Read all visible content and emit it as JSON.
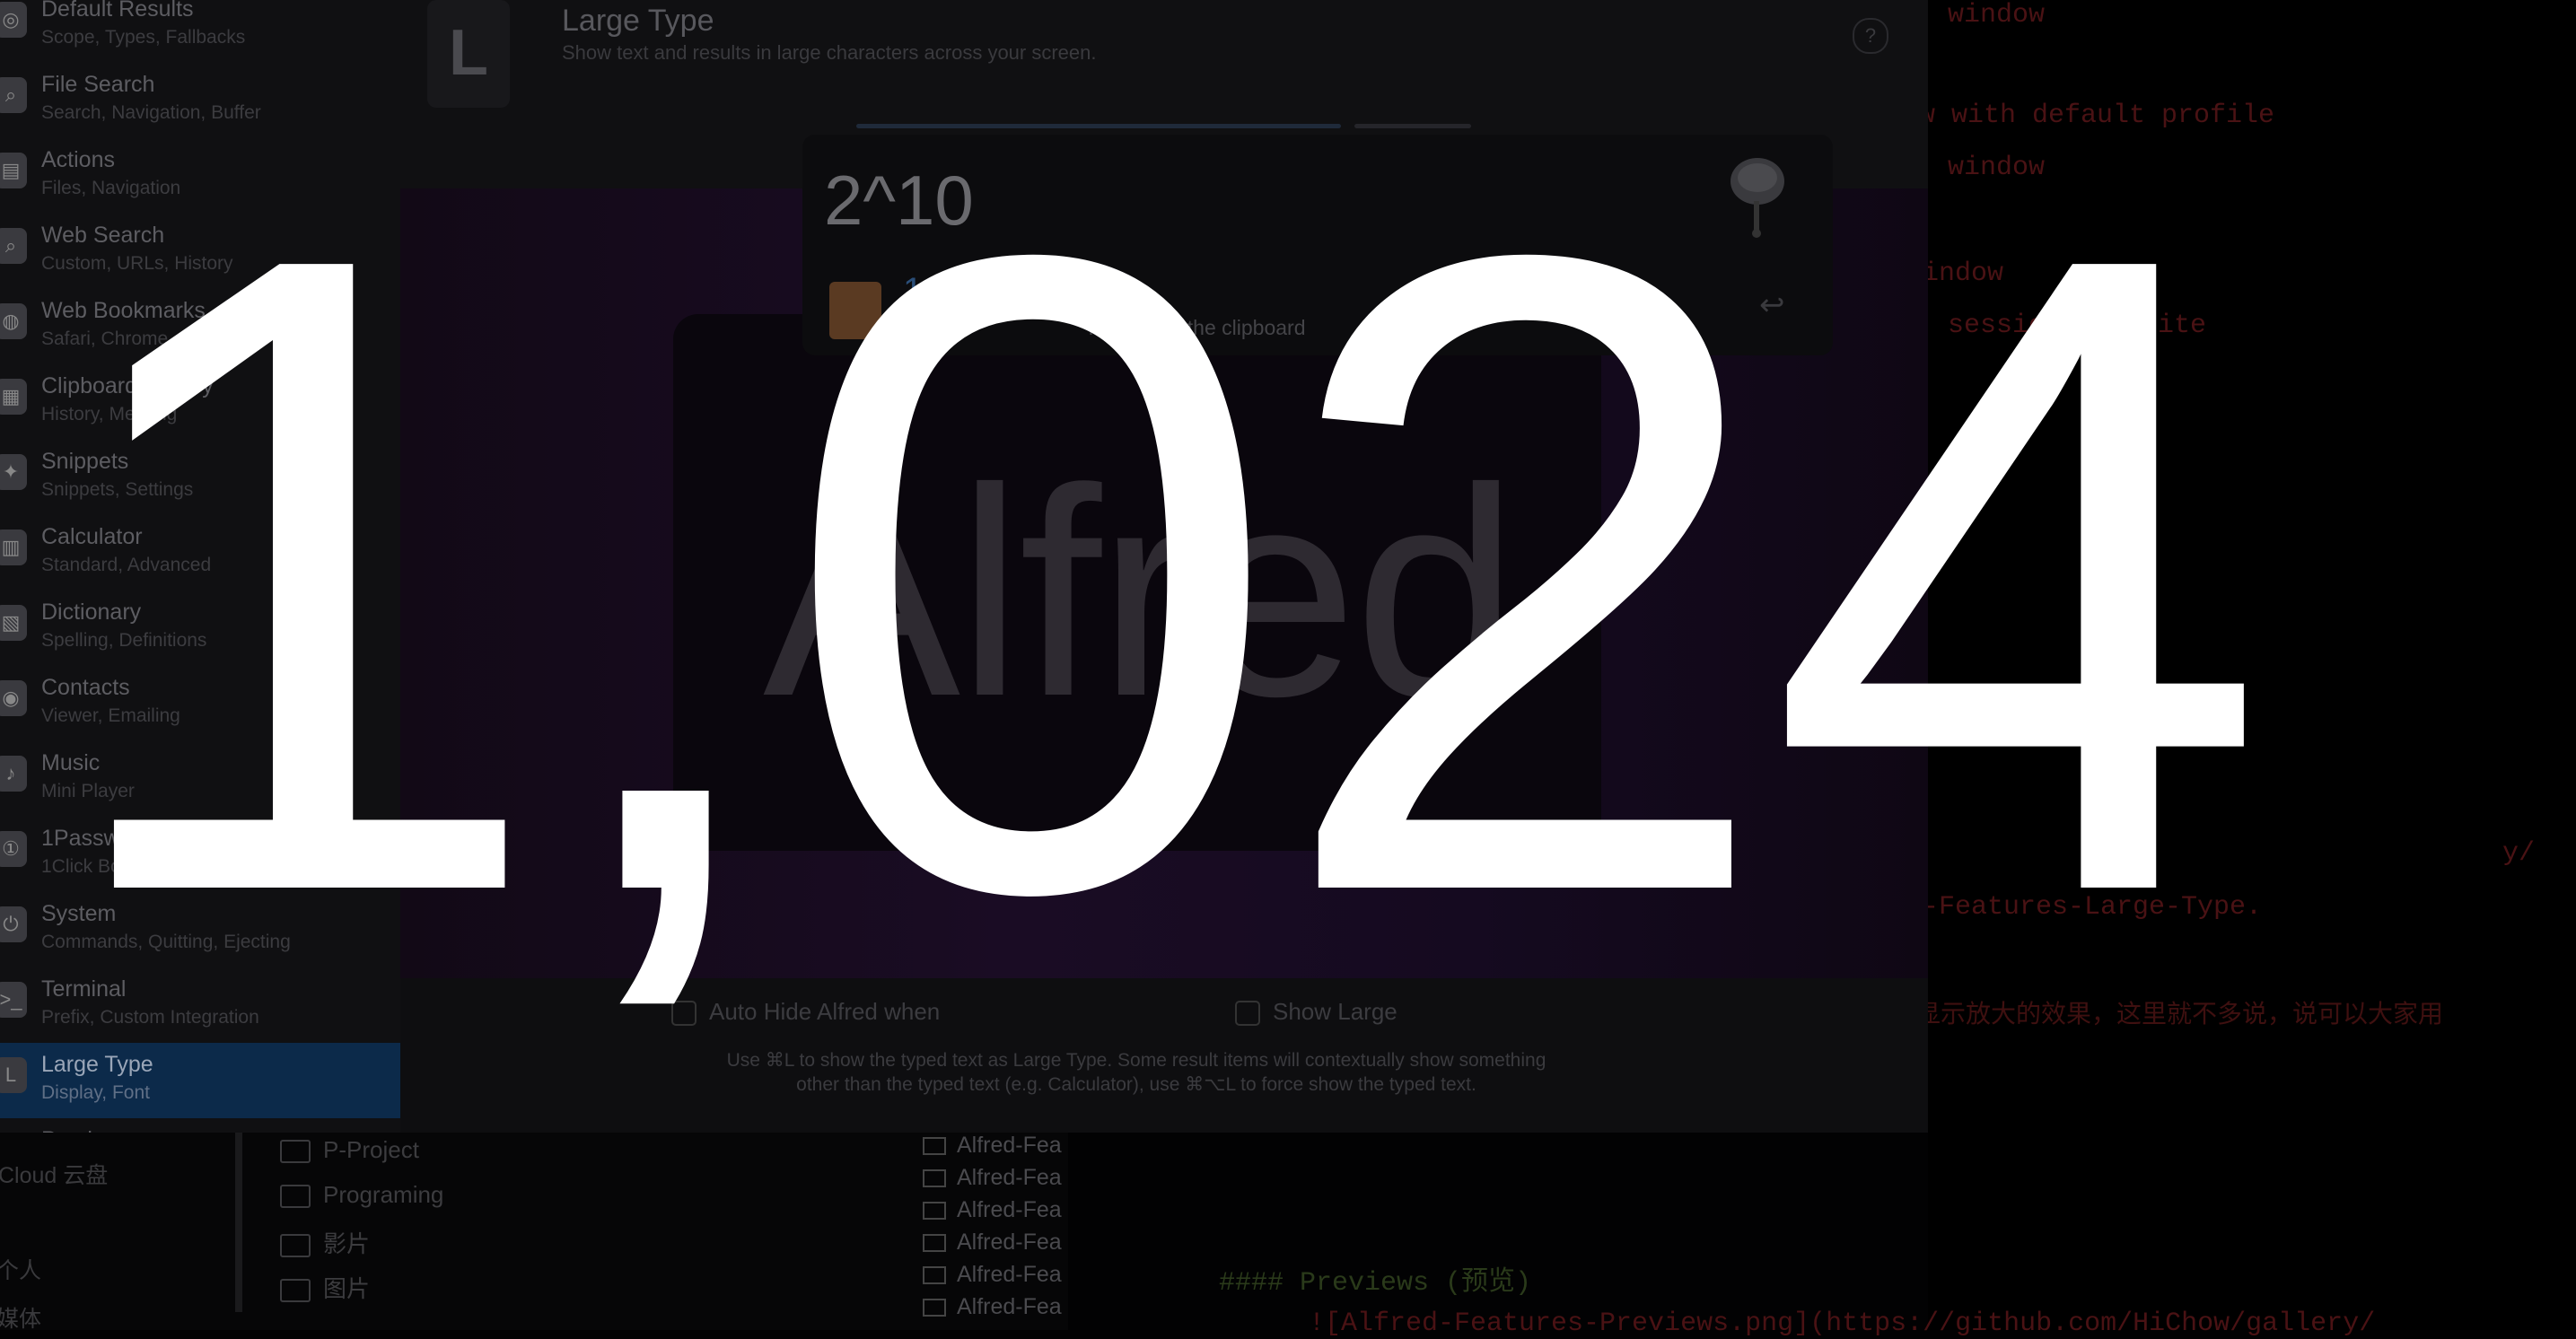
{
  "sidebar": {
    "items": [
      {
        "label": "Default Results",
        "sub": "Scope, Types, Fallbacks",
        "icon": "default-results-icon",
        "glyph": "◎"
      },
      {
        "label": "File Search",
        "sub": "Search, Navigation, Buffer",
        "icon": "file-search-icon",
        "glyph": "⌕"
      },
      {
        "label": "Actions",
        "sub": "Files, Navigation",
        "icon": "actions-icon",
        "glyph": "▤"
      },
      {
        "label": "Web Search",
        "sub": "Custom, URLs, History",
        "icon": "web-search-icon",
        "glyph": "⌕"
      },
      {
        "label": "Web Bookmarks",
        "sub": "Safari, Chrome",
        "icon": "bookmarks-icon",
        "glyph": "◍"
      },
      {
        "label": "Clipboard History",
        "sub": "History, Merging",
        "icon": "clipboard-icon",
        "glyph": "▦"
      },
      {
        "label": "Snippets",
        "sub": "Snippets, Settings",
        "icon": "snippets-icon",
        "glyph": "✦"
      },
      {
        "label": "Calculator",
        "sub": "Standard, Advanced",
        "icon": "calculator-icon",
        "glyph": "▥"
      },
      {
        "label": "Dictionary",
        "sub": "Spelling, Definitions",
        "icon": "dictionary-icon",
        "glyph": "▧"
      },
      {
        "label": "Contacts",
        "sub": "Viewer, Emailing",
        "icon": "contacts-icon",
        "glyph": "◉"
      },
      {
        "label": "Music",
        "sub": "Mini Player",
        "icon": "music-icon",
        "glyph": "♪"
      },
      {
        "label": "1Password",
        "sub": "1Click Bookmarks",
        "icon": "onepassword-icon",
        "glyph": "①"
      },
      {
        "label": "System",
        "sub": "Commands, Quitting, Ejecting",
        "icon": "system-icon",
        "glyph": "⏻"
      },
      {
        "label": "Terminal",
        "sub": "Prefix, Custom Integration",
        "icon": "terminal-icon",
        "glyph": ">_"
      },
      {
        "label": "Large Type",
        "sub": "Display, Font",
        "icon": "large-type-icon",
        "glyph": "L"
      },
      {
        "label": "Previews",
        "sub": "",
        "icon": "previews-icon",
        "glyph": "◫"
      }
    ]
  },
  "prefs": {
    "title": "Large Type",
    "description": "Show text and results in large characters across your screen.",
    "icon_letter": "L",
    "help": "?",
    "watermark": "Alfred",
    "checkbox_auto_hide": "Auto Hide Alfred when",
    "checkbox_show_large": "Show Large",
    "help_text_1": "Use ⌘L to show the typed text as Large Type. Some result items will contextually show something",
    "help_text_2": "other than the typed text (e.g. Calculator), use ⌘⌥L to force show the typed text."
  },
  "alfred": {
    "query": "2^10",
    "result_title": "1,024",
    "result_subtitle_a": "Ac",
    "result_subtitle_b": "number to the clipboard",
    "enter_symbol": "↩"
  },
  "large_type": {
    "text": "1,024"
  },
  "finder": {
    "left_items": [
      "Cloud 云盘",
      "个人",
      "媒体"
    ],
    "folders": [
      "P-Project",
      "Programing",
      "影片",
      "图片"
    ],
    "files": [
      "Alfred-Fea",
      "Alfred-Fea",
      "Alfred-Fea",
      "Alfred-Fea",
      "Alfred-Fea",
      "Alfred-Fea"
    ]
  },
  "editor": {
    "lines": [
      "window",
      "w with default profile",
      "window",
      "indow",
      "session to write"
    ],
    "link_1": "y/",
    "link_2": "-Features-Large-Type.",
    "zh_line": "显示放大的效果，这里就不多说，说可以大家用",
    "heading": "#### Previews (预览)",
    "bottom_link": "![Alfred-Features-Previews.png](https://github.com/HiChow/gallery/"
  },
  "colors": {
    "selection": "#0c2a4a",
    "large_type_text": "#ffffff",
    "result_title": "#2a4e78"
  }
}
